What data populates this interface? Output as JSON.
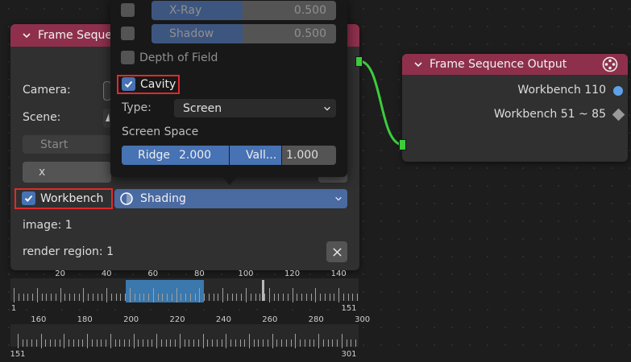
{
  "left_node": {
    "title": "Frame Seque",
    "camera_label": "Camera:",
    "scene_label": "Scene:",
    "start_label": "Start",
    "x_label": "x",
    "workbench_label": "Workbench",
    "workbench_checked": true,
    "shading_label": "Shading",
    "image_text": "image: 1",
    "render_region_text": "render region: 1"
  },
  "output_node": {
    "title": "Frame Sequence Output",
    "sockets": [
      "Workbench 110",
      "Workbench 51 ~ 85"
    ]
  },
  "popover": {
    "xray": {
      "label": "X-Ray",
      "value": "0.500",
      "checked": false
    },
    "shadow": {
      "label": "Shadow",
      "value": "0.500",
      "checked": false
    },
    "depth_of_field": {
      "label": "Depth of Field",
      "checked": false
    },
    "cavity": {
      "label": "Cavity",
      "checked": true
    },
    "type_label": "Type:",
    "type_value": "Screen",
    "screen_space_label": "Screen Space",
    "ridge_label": "Ridge",
    "ridge_value": "2.000",
    "valley_label": "Vall...",
    "valley_value": "1.000"
  },
  "timeline1": {
    "labels": [
      "20",
      "40",
      "60",
      "80",
      "100",
      "120",
      "140"
    ],
    "start_label": "1",
    "end_label": "151",
    "selection_fraction": [
      0.331,
      0.555
    ]
  },
  "timeline2": {
    "labels": [
      "160",
      "180",
      "200",
      "220",
      "240",
      "260",
      "280",
      "300"
    ],
    "start_label": "151",
    "end_label": "301"
  },
  "colors": {
    "header": "#8e304c",
    "accent": "#4772b3",
    "link": "#3ccc3c",
    "highlight": "#e02a2a"
  }
}
